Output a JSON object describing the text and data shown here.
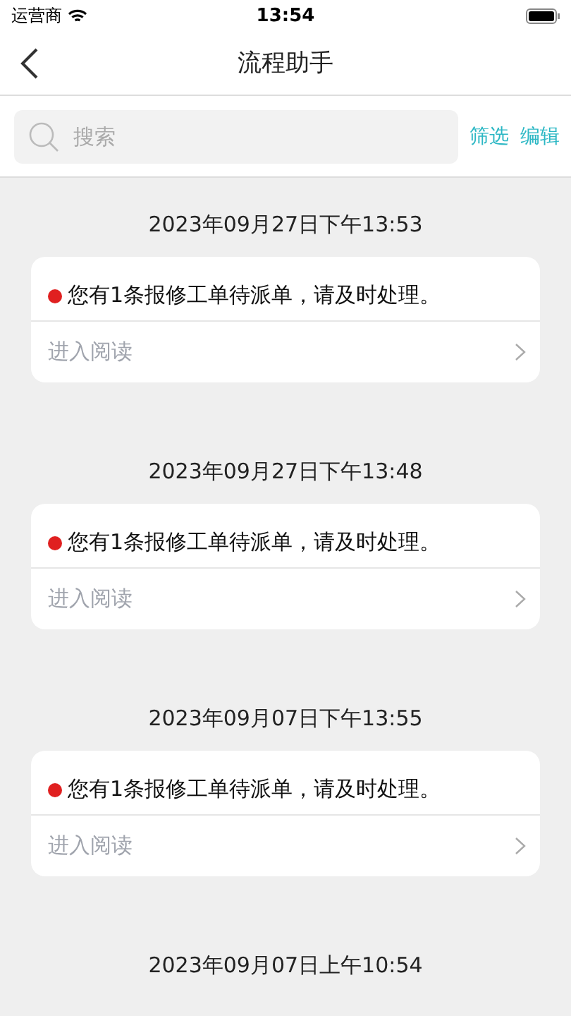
{
  "status_bar": {
    "carrier": "运营商",
    "time": "13:54"
  },
  "nav": {
    "title": "流程助手"
  },
  "search": {
    "placeholder": "搜索",
    "actions": [
      "筛选",
      "编辑"
    ]
  },
  "messages": [
    {
      "date": "2023年09月27日下午13:53",
      "text": "您有1条报修工单待派单，请及时处理。",
      "unread": true,
      "link": "进入阅读"
    },
    {
      "date": "2023年09月27日下午13:48",
      "text": "您有1条报修工单待派单，请及时处理。",
      "unread": true,
      "link": "进入阅读"
    },
    {
      "date": "2023年09月07日下午13:55",
      "text": "您有1条报修工单待派单，请及时处理。",
      "unread": true,
      "link": "进入阅读"
    },
    {
      "date": "2023年09月07日上午10:54"
    }
  ]
}
